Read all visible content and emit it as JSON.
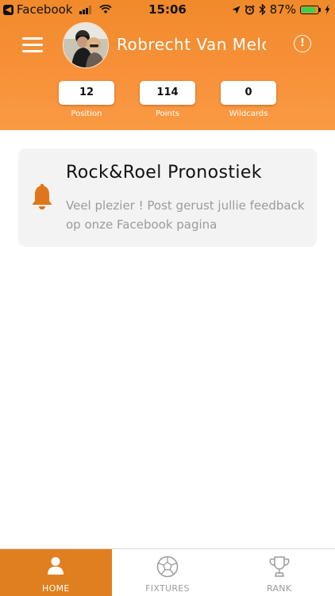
{
  "status_bar": {
    "back_app": "Facebook",
    "time": "15:06",
    "battery_percent": "87%",
    "battery_level": 0.87
  },
  "header": {
    "user_name": "Robrecht Van Melckebeke",
    "stats": [
      {
        "value": "12",
        "label": "Position"
      },
      {
        "value": "114",
        "label": "Points"
      },
      {
        "value": "0",
        "label": "Wildcards"
      }
    ]
  },
  "notice": {
    "title": "Rock&Roel Pronostiek",
    "message": "Veel plezier ! Post gerust jullie feedback op onze Facebook pagina",
    "icon": "bell-icon"
  },
  "tabs": [
    {
      "label": "HOME",
      "icon": "person-icon",
      "active": true
    },
    {
      "label": "FIXTURES",
      "icon": "soccer-ball-icon",
      "active": false
    },
    {
      "label": "RANK",
      "icon": "trophy-icon",
      "active": false
    }
  ],
  "colors": {
    "accent": "#f7913a",
    "active_tab": "#e07f1f",
    "bell": "#e0761a"
  }
}
